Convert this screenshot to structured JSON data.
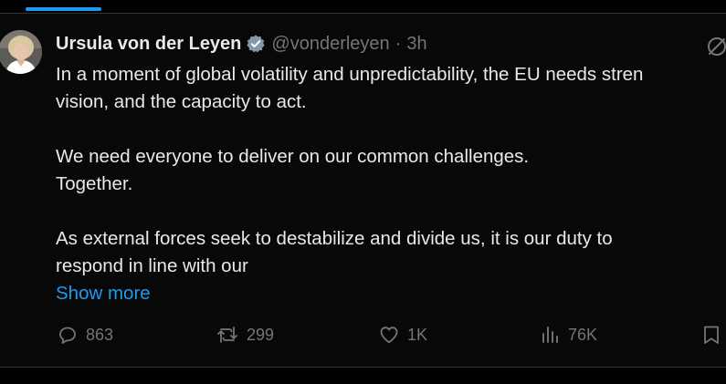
{
  "tweet": {
    "display_name": "Ursula von der Leyen",
    "handle": "@vonderleyen",
    "separator": "·",
    "time": "3h",
    "body": {
      "paragraph1_line1": "In a moment of global volatility and unpredictability, the EU needs stren",
      "paragraph1_line2": "vision, and the capacity to act.",
      "paragraph2_line1": "We need everyone to deliver on our common challenges.",
      "paragraph2_line2": "Together.",
      "paragraph3_line1": "As external forces seek to destabilize and divide us, it is our duty to",
      "paragraph3_line2": "respond in line with our"
    },
    "show_more": "Show more",
    "actions": {
      "replies": "863",
      "retweets": "299",
      "likes": "1K",
      "views": "76K"
    }
  },
  "icons": {
    "verified": "verified-badge-icon",
    "grok": "grok-icon",
    "reply": "reply-icon",
    "retweet": "retweet-icon",
    "like": "heart-icon",
    "views": "views-icon",
    "bookmark": "bookmark-icon"
  },
  "colors": {
    "background": "#000000",
    "tweet_background": "#080808",
    "text": "#e7e9ea",
    "secondary_text": "#71767b",
    "accent": "#1d9bf0",
    "border": "#2f3336"
  }
}
